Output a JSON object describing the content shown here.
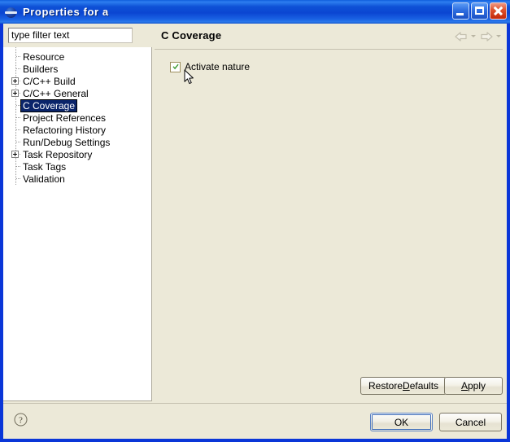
{
  "window": {
    "title": "Properties for a",
    "icon": "eclipse-globe-icon",
    "border_color": "#0a36d8",
    "titlebar_color": "#0b46d2",
    "controls": {
      "minimize": "Minimize",
      "maximize": "Maximize",
      "close": "Close"
    }
  },
  "filter": {
    "value": "type filter text",
    "placeholder": "type filter text"
  },
  "tree": {
    "items": [
      {
        "label": "Resource",
        "expandable": false,
        "selected": false
      },
      {
        "label": "Builders",
        "expandable": false,
        "selected": false
      },
      {
        "label": "C/C++ Build",
        "expandable": true,
        "selected": false
      },
      {
        "label": "C/C++ General",
        "expandable": true,
        "selected": false
      },
      {
        "label": "C Coverage",
        "expandable": false,
        "selected": true
      },
      {
        "label": "Project References",
        "expandable": false,
        "selected": false
      },
      {
        "label": "Refactoring History",
        "expandable": false,
        "selected": false
      },
      {
        "label": "Run/Debug Settings",
        "expandable": false,
        "selected": false
      },
      {
        "label": "Task Repository",
        "expandable": true,
        "selected": false
      },
      {
        "label": "Task Tags",
        "expandable": false,
        "selected": false
      },
      {
        "label": "Validation",
        "expandable": false,
        "selected": false
      }
    ],
    "selection_bg": "#0a246a",
    "selection_fg": "#ffffff"
  },
  "page": {
    "title": "C Coverage",
    "nav": {
      "back": "Back",
      "back_menu": "Back history",
      "forward": "Forward",
      "forward_menu": "Forward history"
    },
    "checkbox": {
      "label": "Activate nature",
      "checked": true,
      "check_color": "#3f9c35"
    },
    "restore_defaults": {
      "pre": "Restore ",
      "mnemonic": "D",
      "post": "efaults"
    },
    "apply": {
      "pre": "",
      "mnemonic": "A",
      "post": "pply"
    }
  },
  "footer": {
    "help": "?",
    "ok": "OK",
    "cancel": "Cancel"
  }
}
